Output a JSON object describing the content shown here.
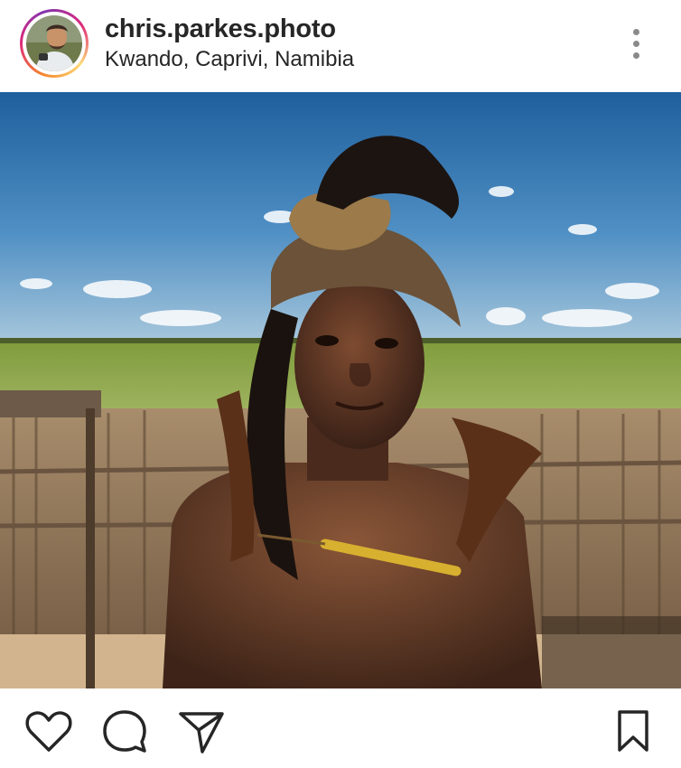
{
  "post": {
    "username": "chris.parkes.photo",
    "location": "Kwando, Caprivi, Namibia"
  },
  "header": {
    "avatar_icon": "profile-avatar",
    "menu_icon": "more-vertical-icon"
  },
  "photo": {
    "subject": "portrait-photo"
  },
  "actions": {
    "icons": [
      "heart-icon",
      "comment-icon",
      "share-icon",
      "bookmark-icon"
    ]
  },
  "colors": {
    "text": "#262626",
    "ring_start": "#f58529",
    "ring_end": "#dd2a7b",
    "icon": "#262626"
  }
}
